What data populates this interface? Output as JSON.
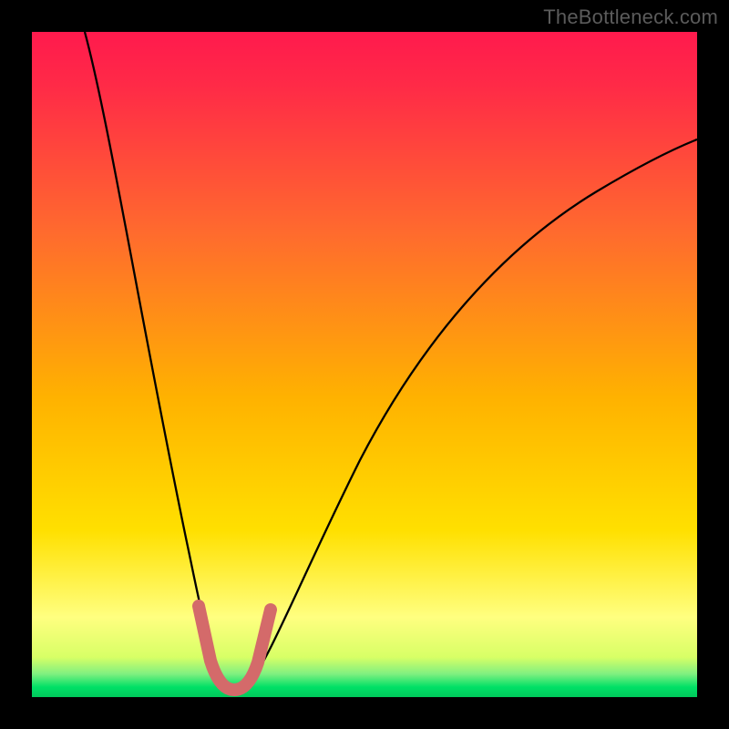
{
  "watermark": "TheBottleneck.com",
  "colors": {
    "bg": "#000000",
    "grad_top": "#ff1a4d",
    "grad_mid1": "#ff6a2e",
    "grad_mid2": "#ffd400",
    "grad_mid3": "#ffff73",
    "grad_bot": "#00e066",
    "curve": "#000000",
    "marker": "#d46a6a"
  },
  "chart_data": {
    "type": "line",
    "title": "",
    "xlabel": "",
    "ylabel": "",
    "xlim": [
      0,
      100
    ],
    "ylim": [
      0,
      100
    ],
    "x_min_curve": 8,
    "x_trough_start": 26,
    "x_trough_end": 33,
    "x_max_curve": 100,
    "y_at_xmin": 100,
    "y_trough": 1,
    "y_at_xmax": 75,
    "marker_region": {
      "x_start": 24,
      "x_end": 35,
      "y_low": 0,
      "y_high": 12
    },
    "series": [
      {
        "name": "bottleneck-curve",
        "points": [
          {
            "x": 8,
            "y": 100
          },
          {
            "x": 12,
            "y": 82
          },
          {
            "x": 16,
            "y": 62
          },
          {
            "x": 20,
            "y": 40
          },
          {
            "x": 23,
            "y": 22
          },
          {
            "x": 25,
            "y": 10
          },
          {
            "x": 27,
            "y": 3
          },
          {
            "x": 29,
            "y": 1
          },
          {
            "x": 31,
            "y": 2
          },
          {
            "x": 33,
            "y": 5
          },
          {
            "x": 36,
            "y": 12
          },
          {
            "x": 40,
            "y": 22
          },
          {
            "x": 46,
            "y": 34
          },
          {
            "x": 54,
            "y": 46
          },
          {
            "x": 62,
            "y": 55
          },
          {
            "x": 72,
            "y": 63
          },
          {
            "x": 84,
            "y": 70
          },
          {
            "x": 100,
            "y": 75
          }
        ]
      }
    ]
  }
}
